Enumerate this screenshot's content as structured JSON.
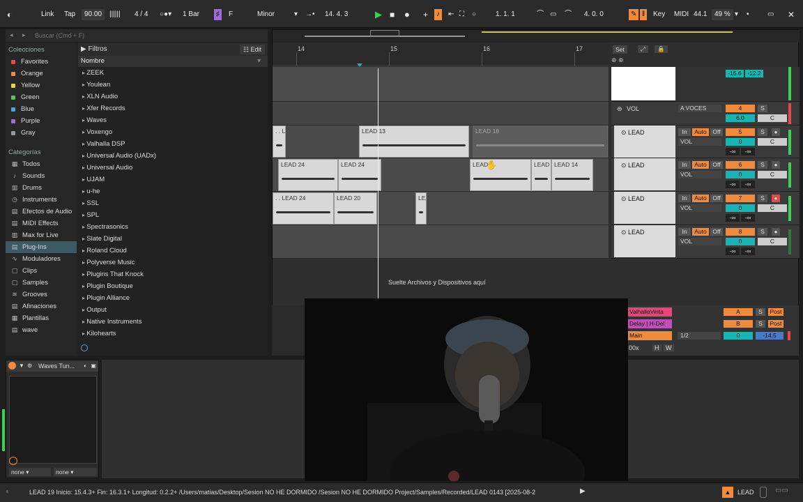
{
  "transport": {
    "link": "Link",
    "tap": "Tap",
    "tempo": "90.00",
    "signature": "4 / 4",
    "quantize": "1 Bar",
    "key_root": "F",
    "scale": "Minor",
    "position": "14.  4.  3",
    "loop_start": "1.  1.  1",
    "loop_len": "4.  0.  0",
    "key": "Key",
    "midi": "MIDI",
    "cpu": "44.1",
    "cpu_pct": "49 %",
    "colors": {
      "accent": "#f08a3c",
      "play": "#39d353",
      "scale_mode": "#a66bd6"
    }
  },
  "browser": {
    "search_placeholder": "Buscar (Cmd + F)",
    "colecciones_label": "Colecciones",
    "collections": [
      {
        "label": "Favorites",
        "color": "#e2484c"
      },
      {
        "label": "Orange",
        "color": "#f08a3c"
      },
      {
        "label": "Yellow",
        "color": "#e8d44d"
      },
      {
        "label": "Green",
        "color": "#58c558"
      },
      {
        "label": "Blue",
        "color": "#4aa3df"
      },
      {
        "label": "Purple",
        "color": "#a66bd6"
      },
      {
        "label": "Gray",
        "color": "#999999"
      }
    ],
    "categorias_label": "Categorías",
    "categories": [
      "Todos",
      "Sounds",
      "Drums",
      "Instruments",
      "Efectos de Audio",
      "MIDI Effects",
      "Max for Live",
      "Plug-Ins",
      "Moduladores",
      "Clips",
      "Samples",
      "Grooves",
      "Afinaciones",
      "Plantillas",
      "wave"
    ],
    "selected_category": "Plug-Ins",
    "filters_label": "Filtros",
    "edit_label": "Edit",
    "name_header": "Nombre",
    "items": [
      "ZEEK",
      "Youlean",
      "XLN Audio",
      "Xfer Records",
      "Waves",
      "Voxengo",
      "Valhalla DSP",
      "Universal Audio (UADx)",
      "Universal Audio",
      "UJAM",
      "u-he",
      "SSL",
      "SPL",
      "Spectrasonics",
      "Slate Digital",
      "Roland Cloud",
      "Polyverse Music",
      "Plugins That Knock",
      "Plugin Boutique",
      "Plugin Alliance",
      "Output",
      "Native Instruments",
      "Kilohearts"
    ]
  },
  "ruler": {
    "bars": [
      "14",
      "15",
      "16",
      "17"
    ],
    "set": "Set"
  },
  "clips": {
    "lane1": [
      {
        "name": ". . L",
        "dim": false
      },
      {
        "name": "LEAD 13",
        "dim": false
      },
      {
        "name": "LEAD 18",
        "dim": true
      }
    ],
    "lane2": [
      {
        "name": "LEAD 24"
      },
      {
        "name": "LEAD 24"
      },
      {
        "name": "LEAD"
      },
      {
        "name": "LEAD"
      },
      {
        "name": "LEAD 14"
      }
    ],
    "lane3": [
      {
        "name": ". . LEAD 24"
      },
      {
        "name": "LEAD 20"
      },
      {
        "name": "LEA"
      }
    ]
  },
  "drop_text": "Suelte Archivos y Dispositivos aquí",
  "mixer": {
    "master_levels": [
      "-15.6",
      "-12.2"
    ],
    "vol_group": {
      "name": "VOL",
      "input": "A VOCES",
      "num": "4",
      "send": "6.0",
      "s": "S",
      "c": "C"
    },
    "tracks": [
      {
        "name": "LEAD",
        "num": "5",
        "in": "In",
        "auto": "Auto",
        "off": "Off",
        "vol": "VOL",
        "zero": "0",
        "c": "C",
        "s": "S",
        "inf1": "-∞",
        "inf2": "-∞"
      },
      {
        "name": "LEAD",
        "num": "6",
        "in": "In",
        "auto": "Auto",
        "off": "Off",
        "vol": "VOL",
        "zero": "0",
        "c": "C",
        "s": "S",
        "inf1": "-∞",
        "inf2": "-∞"
      },
      {
        "name": "LEAD",
        "num": "7",
        "in": "In",
        "auto": "Auto",
        "off": "Off",
        "vol": "VOL",
        "zero": "0",
        "c": "C",
        "s": "S",
        "inf1": "-∞",
        "inf2": "-∞"
      },
      {
        "name": "LEAD",
        "num": "8",
        "in": "In",
        "auto": "Auto",
        "off": "Off",
        "vol": "VOL",
        "zero": "0",
        "c": "C",
        "s": "S",
        "inf1": "-∞",
        "inf2": "-∞"
      }
    ],
    "returns": [
      {
        "name": "ValhallaVinta",
        "letter": "A",
        "s": "S",
        "post": "Post",
        "color": "#e2487a"
      },
      {
        "name": "Delay | H-Del",
        "letter": "B",
        "s": "S",
        "post": "Post",
        "color": "#c04fb8"
      },
      {
        "name": "Main",
        "letter": "1/2",
        "zero": "0",
        "level": "-14.5",
        "color": "#f08a3c"
      }
    ],
    "zoom": "00x",
    "h": "H",
    "w": "W"
  },
  "device": {
    "title": "Waves Tun...",
    "sel1": "none",
    "sel2": "none"
  },
  "status": {
    "text": "LEAD 19  Inicio: 15.4.3+  Fin: 16.3.1+  Longitud: 0.2.2+  /Users/matias/Desktop/Sesion NO HE DORMIDO /Sesion NO HE DORMIDO Project/Samples/Recorded/LEAD 0143 [2025-08-2",
    "track": "LEAD"
  }
}
